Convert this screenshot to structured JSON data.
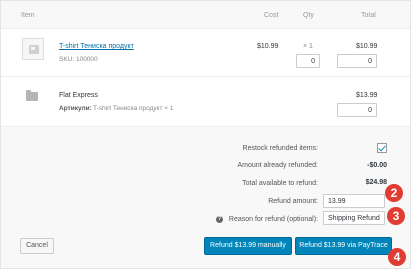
{
  "header": {
    "item": "Item",
    "cost": "Cost",
    "qty": "Qty",
    "total": "Total"
  },
  "product": {
    "name": "T-shirt Тениска продукт",
    "sku": "SKU: 100000",
    "cost": "$10.99",
    "qty": "× 1",
    "qty_refund": "0",
    "total": "$10.99",
    "total_refund": "0"
  },
  "shipping": {
    "name": "Flat Express",
    "meta_key": "Артикули:",
    "meta_value": "T-shirt Тениска продукт × 1",
    "total": "$13.99",
    "total_refund": "0"
  },
  "refund": {
    "restock_label": "Restock refunded items:",
    "already_label": "Amount already refunded:",
    "already_value": "-$0.00",
    "available_label": "Total available to refund:",
    "available_value": "$24.98",
    "amount_label": "Refund amount:",
    "amount_value": "13.99",
    "reason_label": "Reason for refund (optional):",
    "reason_value": "Shipping Refund"
  },
  "buttons": {
    "cancel": "Cancel",
    "manual": "Refund $13.99 manually",
    "paytrace": "Refund $13.99 via PayTrace"
  },
  "badges": {
    "b2": "2",
    "b3": "3",
    "b4": "4"
  },
  "colors": {
    "accent": "#0085ba",
    "link": "#0073aa",
    "badge": "#e03c31"
  }
}
